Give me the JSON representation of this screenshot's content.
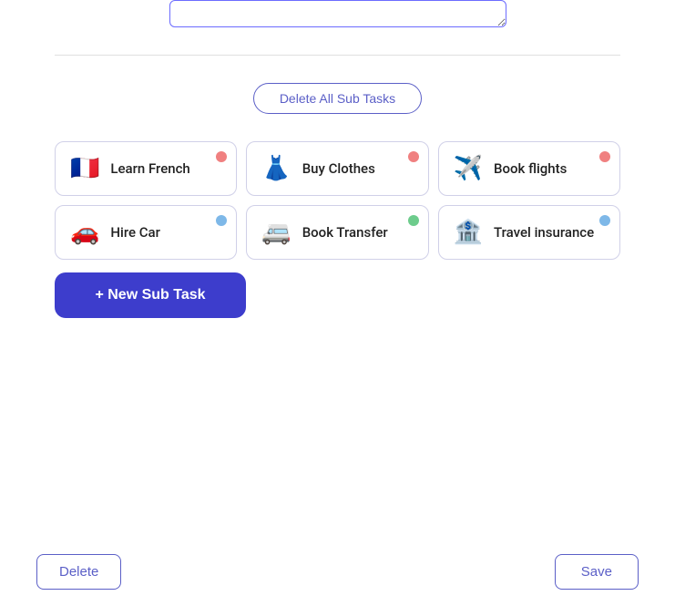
{
  "textarea": {
    "value": "",
    "placeholder": ""
  },
  "buttons": {
    "delete_all_label": "Delete All Sub Tasks",
    "new_subtask_label": "+ New Sub Task",
    "delete_label": "Delete",
    "save_label": "Save"
  },
  "tasks": [
    {
      "id": "learn-french",
      "label": "Learn French",
      "emoji": "🇫🇷",
      "dot_class": "dot-red"
    },
    {
      "id": "buy-clothes",
      "label": "Buy Clothes",
      "emoji": "👗",
      "dot_class": "dot-red"
    },
    {
      "id": "book-flights",
      "label": "Book flights",
      "emoji": "✈️",
      "dot_class": "dot-red"
    },
    {
      "id": "hire-car",
      "label": "Hire Car",
      "emoji": "🚗",
      "dot_class": "dot-blue"
    },
    {
      "id": "book-transfer",
      "label": "Book Transfer",
      "emoji": "🚐",
      "dot_class": "dot-green"
    },
    {
      "id": "travel-insurance",
      "label": "Travel insurance",
      "emoji": "🏦",
      "dot_class": "dot-blue"
    }
  ]
}
